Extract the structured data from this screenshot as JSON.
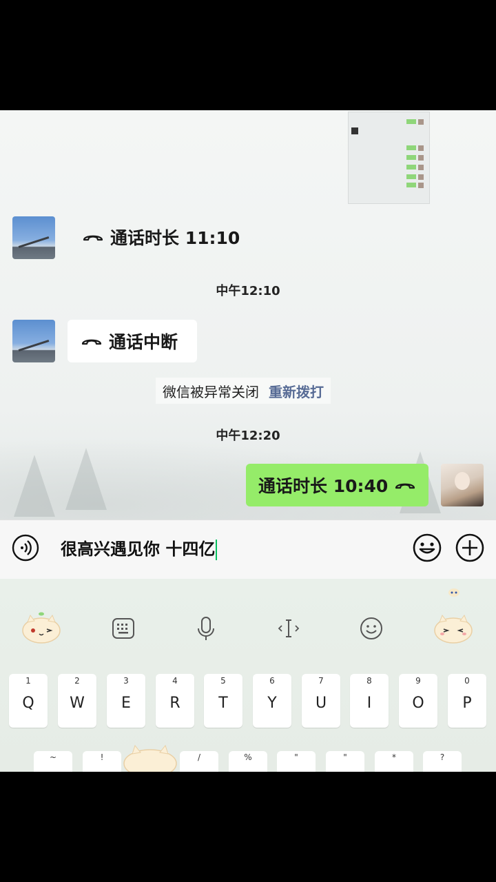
{
  "chat": {
    "call1_text": "通话时长 11:10",
    "time1": "中午12:10",
    "call2_text": "通话中断",
    "system_msg": "微信被异常关闭",
    "redial_link": "重新拨打",
    "time2": "中午12:20",
    "call3_text": "通话时长 10:40"
  },
  "input": {
    "value": "很高兴遇见你 十四亿"
  },
  "keyboard": {
    "toolbar_icons": [
      "mascot-icon",
      "keyboard-icon",
      "microphone-icon",
      "cursor-icon",
      "emoji-icon",
      "mascot-icon"
    ],
    "row1": [
      {
        "num": "1",
        "letter": "Q"
      },
      {
        "num": "2",
        "letter": "W"
      },
      {
        "num": "3",
        "letter": "E"
      },
      {
        "num": "4",
        "letter": "R"
      },
      {
        "num": "5",
        "letter": "T"
      },
      {
        "num": "6",
        "letter": "Y"
      },
      {
        "num": "7",
        "letter": "U"
      },
      {
        "num": "8",
        "letter": "I"
      },
      {
        "num": "9",
        "letter": "O"
      },
      {
        "num": "0",
        "letter": "P"
      }
    ],
    "row2_symbols": [
      "~",
      "!",
      "@",
      "/",
      "%",
      "\"",
      "\"",
      "*",
      "?"
    ]
  },
  "colors": {
    "sent_bubble": "#95ec69",
    "link": "#576b95",
    "caret": "#07c160"
  }
}
